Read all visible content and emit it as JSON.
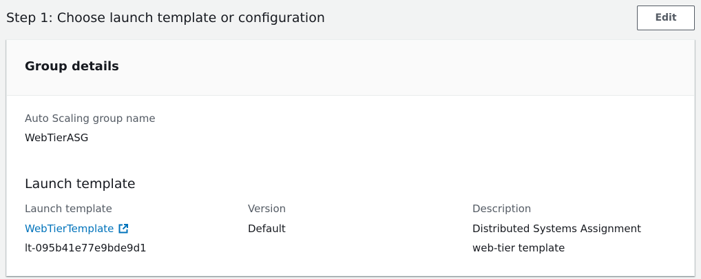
{
  "step": {
    "title": "Step 1: Choose launch template or configuration",
    "edit_label": "Edit"
  },
  "group_details": {
    "title": "Group details",
    "asg_name_label": "Auto Scaling group name",
    "asg_name_value": "WebTierASG"
  },
  "launch_template_section": {
    "heading": "Launch template",
    "template_label": "Launch template",
    "template_link": "WebTierTemplate",
    "template_link_icon": "external-link-icon",
    "template_id": "lt-095b41e77e9bde9d1",
    "version_label": "Version",
    "version_value": "Default",
    "description_label": "Description",
    "description_line1": "Distributed Systems Assignment",
    "description_line2": "web-tier template"
  },
  "colors": {
    "link": "#0073bb",
    "label": "#545b64",
    "text": "#16191f",
    "background": "#f2f3f3",
    "panel_header": "#fafafa"
  }
}
